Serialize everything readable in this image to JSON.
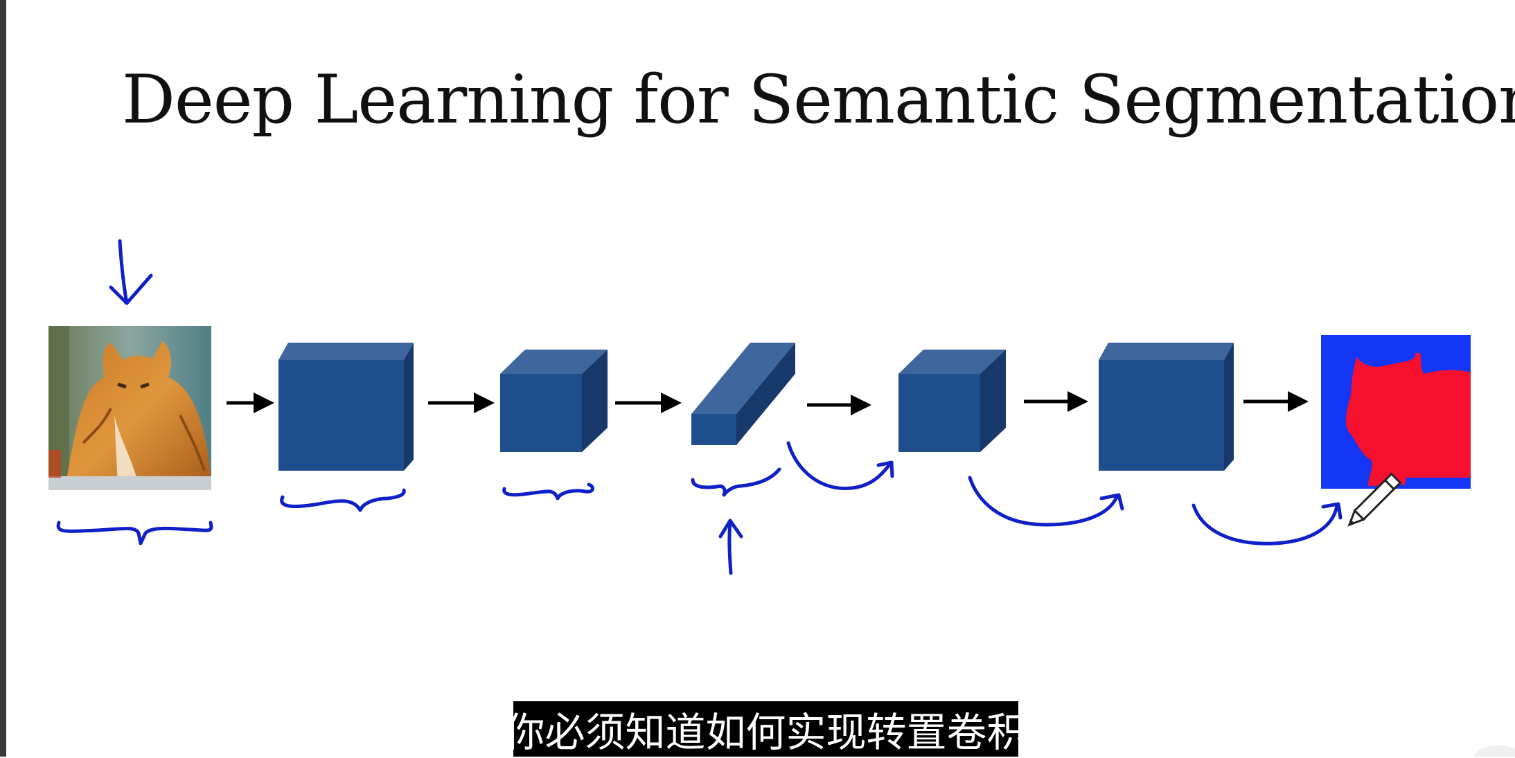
{
  "slide": {
    "title": "Deep Learning for Semantic Segmentation"
  },
  "subtitle": {
    "text": "你必须知道如何实现转置卷积"
  },
  "colors": {
    "box_front": "#1f4e8c",
    "box_top": "#3f679e",
    "box_side": "#17396b",
    "annotation_ink": "#1020c8",
    "arrow": "#000000",
    "segmap_background": "#1436f5",
    "segmap_cat": "#f5102e"
  },
  "icons": [
    "pencil-icon",
    "arrow-right-icon"
  ]
}
